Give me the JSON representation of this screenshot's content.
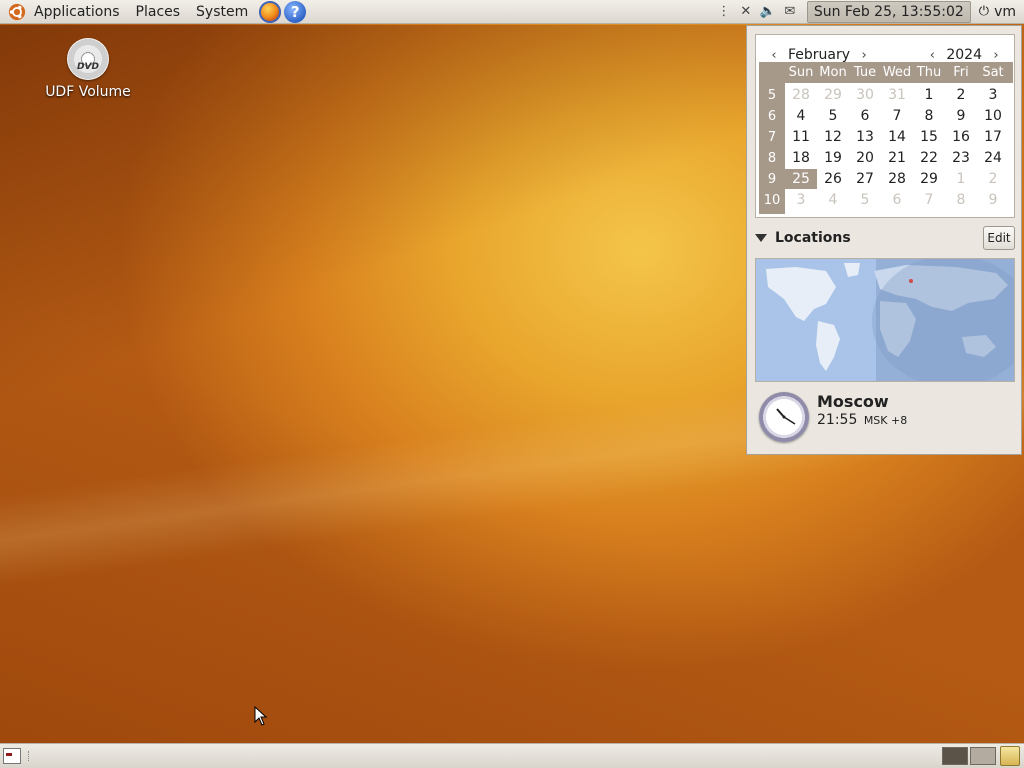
{
  "top_panel": {
    "menus": [
      "Applications",
      "Places",
      "System"
    ],
    "clock": "Sun Feb 25, 13:55:02",
    "user": "vm"
  },
  "desktop": {
    "icons": [
      {
        "label": "UDF Volume",
        "icon": "dvd-icon",
        "badge": "DVD"
      }
    ]
  },
  "calendar": {
    "month": "February",
    "year": "2024",
    "weekdays": [
      "Sun",
      "Mon",
      "Tue",
      "Wed",
      "Thu",
      "Fri",
      "Sat"
    ],
    "weeks": [
      {
        "num": "5",
        "days": [
          {
            "d": "28",
            "other": true
          },
          {
            "d": "29",
            "other": true
          },
          {
            "d": "30",
            "other": true
          },
          {
            "d": "31",
            "other": true
          },
          {
            "d": "1"
          },
          {
            "d": "2"
          },
          {
            "d": "3"
          }
        ]
      },
      {
        "num": "6",
        "days": [
          {
            "d": "4"
          },
          {
            "d": "5"
          },
          {
            "d": "6"
          },
          {
            "d": "7"
          },
          {
            "d": "8"
          },
          {
            "d": "9"
          },
          {
            "d": "10"
          }
        ]
      },
      {
        "num": "7",
        "days": [
          {
            "d": "11"
          },
          {
            "d": "12"
          },
          {
            "d": "13"
          },
          {
            "d": "14"
          },
          {
            "d": "15"
          },
          {
            "d": "16"
          },
          {
            "d": "17"
          }
        ]
      },
      {
        "num": "8",
        "days": [
          {
            "d": "18"
          },
          {
            "d": "19"
          },
          {
            "d": "20"
          },
          {
            "d": "21"
          },
          {
            "d": "22"
          },
          {
            "d": "23"
          },
          {
            "d": "24"
          }
        ]
      },
      {
        "num": "9",
        "days": [
          {
            "d": "25",
            "today": true
          },
          {
            "d": "26"
          },
          {
            "d": "27"
          },
          {
            "d": "28"
          },
          {
            "d": "29"
          },
          {
            "d": "1",
            "other": true
          },
          {
            "d": "2",
            "other": true
          }
        ]
      },
      {
        "num": "10",
        "days": [
          {
            "d": "3",
            "other": true
          },
          {
            "d": "4",
            "other": true
          },
          {
            "d": "5",
            "other": true
          },
          {
            "d": "6",
            "other": true
          },
          {
            "d": "7",
            "other": true
          },
          {
            "d": "8",
            "other": true
          },
          {
            "d": "9",
            "other": true
          }
        ]
      }
    ]
  },
  "locations": {
    "title": "Locations",
    "edit_label": "Edit",
    "city": {
      "name": "Moscow",
      "time": "21:55",
      "tz": "MSK +8"
    }
  },
  "colors": {
    "calendar_header": "#a6998a",
    "panel": "#e6e2db",
    "desktop_accent": "#e9a62d"
  }
}
